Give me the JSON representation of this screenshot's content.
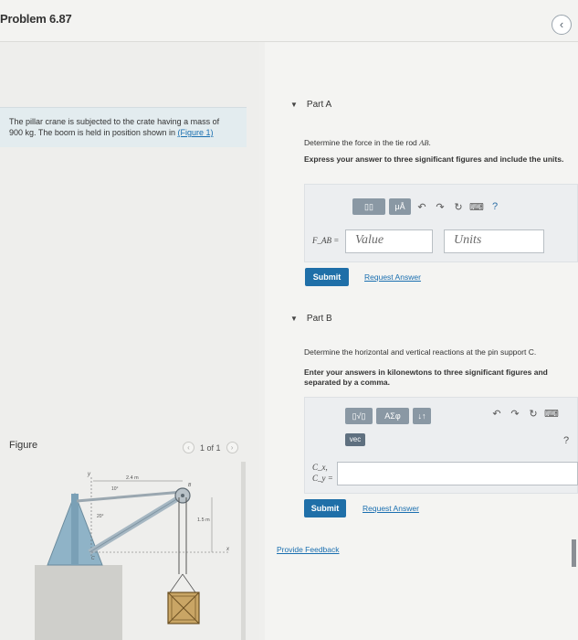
{
  "header": {
    "title": "Problem 6.87",
    "nav_icon": "‹"
  },
  "problem": {
    "line1": "The pillar crane is subjected to the crate having a mass of",
    "line2_a": "900 kg",
    "line2_b": ". The boom is held in position shown in ",
    "figure_link": "(Figure 1)"
  },
  "figure": {
    "label": "Figure",
    "pager_text": "1 of 1",
    "prev_icon": "‹",
    "next_icon": "›",
    "dim_top": "2.4 m",
    "angle_top": "10°",
    "angle_left": "20°",
    "dim_right": "1.5 m",
    "label_b": "B",
    "label_c": "C",
    "label_y": "y",
    "label_x": "x"
  },
  "partA": {
    "caret": "▼",
    "title": "Part A",
    "question_a": "Determine the force in the tie rod ",
    "question_b": "AB",
    "question_c": ".",
    "instruction": "Express your answer to three significant figures and include the units.",
    "tool_templates": "▯▯",
    "tool_mu": "μÅ",
    "undo_icon": "↶",
    "redo_icon": "↷",
    "reset_icon": "↻",
    "keyboard_icon": "⌨",
    "help_icon": "?",
    "var_label": "F_AB =",
    "value_placeholder": "Value",
    "units_placeholder": "Units",
    "submit": "Submit",
    "request": "Request Answer"
  },
  "partB": {
    "caret": "▼",
    "title": "Part B",
    "question": "Determine the horizontal and vertical reactions at the pin support C.",
    "instruction": "Enter your answers in kilonewtons to three significant figures and separated by a comma.",
    "tool_sqrt": "▯√▯",
    "tool_greek": "ΑΣφ",
    "tool_arrows": "↓↑",
    "vec": "vec",
    "undo_icon": "↶",
    "redo_icon": "↷",
    "reset_icon": "↻",
    "keyboard_icon": "⌨",
    "help_icon": "?",
    "var_label_1": "C_x,",
    "var_label_2": "C_y =",
    "submit": "Submit",
    "request": "Request Answer"
  },
  "feedback": "Provide Feedback"
}
